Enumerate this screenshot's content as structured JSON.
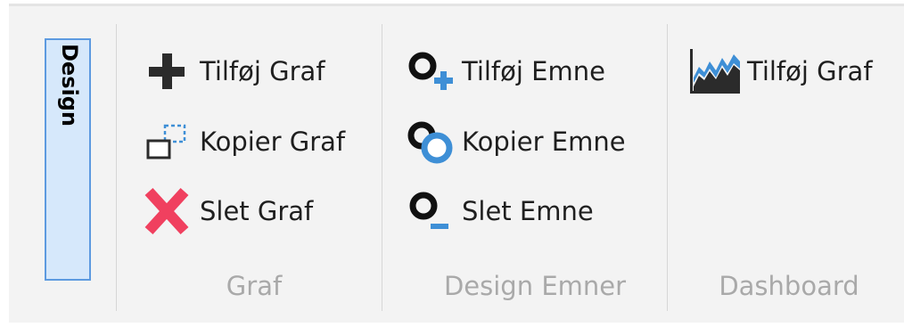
{
  "tab": {
    "label": "Design"
  },
  "groups": [
    {
      "name": "Graf",
      "buttons": [
        {
          "label": "Tilføj Graf",
          "icon": "plus-icon"
        },
        {
          "label": "Kopier Graf",
          "icon": "copy-icon"
        },
        {
          "label": "Slet Graf",
          "icon": "delete-x-icon"
        }
      ]
    },
    {
      "name": "Design Emner",
      "buttons": [
        {
          "label": "Tilføj Emne",
          "icon": "add-item-icon"
        },
        {
          "label": "Kopier Emne",
          "icon": "copy-item-icon"
        },
        {
          "label": "Slet Emne",
          "icon": "delete-item-icon"
        }
      ]
    },
    {
      "name": "Dashboard",
      "buttons": [
        {
          "label": "Tilføj Graf",
          "icon": "area-chart-icon"
        }
      ]
    }
  ],
  "colors": {
    "ribbon_bg": "#f3f3f3",
    "tab_fill": "#d6e8fb",
    "tab_border": "#5d9ae0",
    "delete_red": "#f0405f",
    "accent_blue": "#3e8fd6",
    "group_label": "#a9a9a9"
  }
}
